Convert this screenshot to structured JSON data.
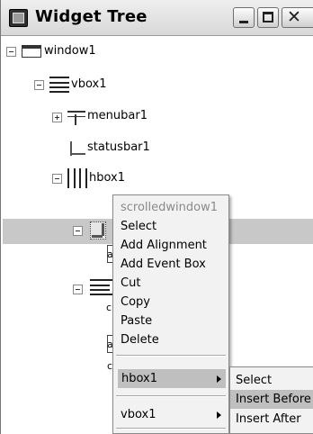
{
  "window": {
    "title": "Widget Tree"
  },
  "icons": {
    "app": "widget-tree-app-icon",
    "minimize": "minimize-icon",
    "maximize": "maximize-icon",
    "close": "close-icon",
    "expanders": "tree-expander-icon",
    "window": "window-widget-icon",
    "vbox": "vbox-widget-icon",
    "hbox": "hbox-widget-icon",
    "menubar": "menubar-widget-icon",
    "statusbar": "statusbar-widget-icon",
    "scrolledwindow": "scrolledwindow-widget-icon",
    "submenu_arrow": "submenu-arrow-icon"
  },
  "window_buttons": {
    "close_glyph": "✕"
  },
  "tree": {
    "nodes": [
      {
        "label": "window1",
        "expanded": true
      },
      {
        "label": "vbox1",
        "expanded": true
      },
      {
        "label": "menubar1",
        "expanded": false
      },
      {
        "label": "statusbar1"
      },
      {
        "label": "hbox1",
        "expanded": true
      }
    ],
    "partial_chars": {
      "a1": "a",
      "a2": "c",
      "a3": "a",
      "a4": "c"
    }
  },
  "context_menu": {
    "header": "scrolledwindow1",
    "items": [
      "Select",
      "Add Alignment",
      "Add Event Box",
      "Cut",
      "Copy",
      "Paste",
      "Delete"
    ],
    "submenus": [
      "hbox1",
      "vbox1"
    ]
  },
  "submenu": {
    "items": [
      "Select",
      "Insert Before",
      "Insert After"
    ],
    "highlighted": "Insert Before"
  },
  "colors": {
    "selection": "#c8c8c8",
    "menu_bg": "#f2f2f2",
    "menu_highlight": "#bfbfbf",
    "disabled_text": "#8a8a8a"
  }
}
